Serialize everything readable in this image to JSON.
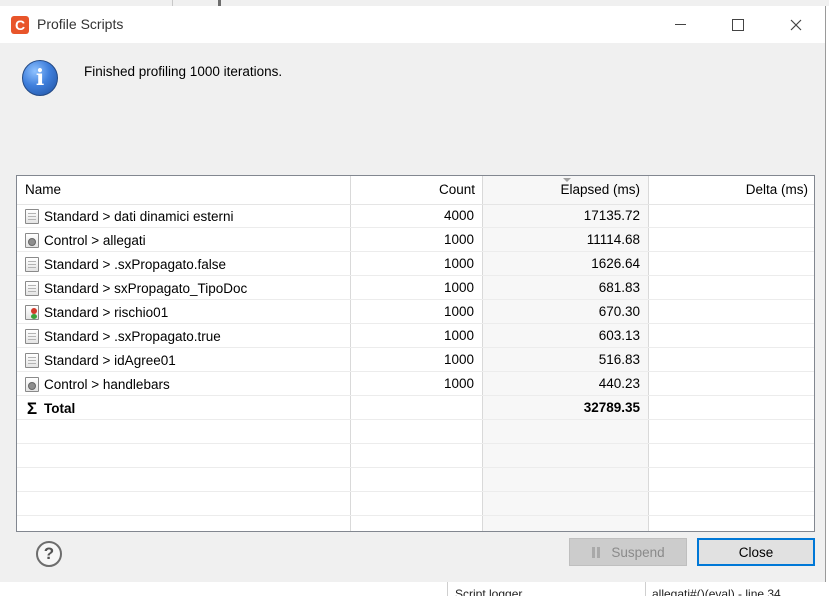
{
  "background": {
    "bottom_tabs": [
      "Script logger",
      "allegati#()(eval) - line 34"
    ]
  },
  "dialog": {
    "title": "Profile Scripts",
    "app_icon_letter": "C",
    "message": "Finished profiling 1000 iterations.",
    "columns": {
      "name": "Name",
      "count": "Count",
      "elapsed": "Elapsed (ms)",
      "delta": "Delta (ms)"
    },
    "rows": [
      {
        "icon": "script-icon",
        "name": "Standard > dati dinamici esterni",
        "count": "4000",
        "elapsed": "17135.72",
        "delta": ""
      },
      {
        "icon": "control-script-icon",
        "name": "Control > allegati",
        "count": "1000",
        "elapsed": "11114.68",
        "delta": ""
      },
      {
        "icon": "script-icon",
        "name": "Standard > .sxPropagato.false",
        "count": "1000",
        "elapsed": "1626.64",
        "delta": ""
      },
      {
        "icon": "script-icon",
        "name": "Standard > sxPropagato_TipoDoc",
        "count": "1000",
        "elapsed": "681.83",
        "delta": ""
      },
      {
        "icon": "breakpoint-script-icon",
        "name": "Standard > rischio01",
        "count": "1000",
        "elapsed": "670.30",
        "delta": ""
      },
      {
        "icon": "script-icon",
        "name": "Standard > .sxPropagato.true",
        "count": "1000",
        "elapsed": "603.13",
        "delta": ""
      },
      {
        "icon": "script-icon",
        "name": "Standard > idAgree01",
        "count": "1000",
        "elapsed": "516.83",
        "delta": ""
      },
      {
        "icon": "control-script-icon",
        "name": "Control > handlebars",
        "count": "1000",
        "elapsed": "440.23",
        "delta": ""
      }
    ],
    "total": {
      "icon": "sigma-icon",
      "name": "Total",
      "count": "",
      "elapsed": "32789.35",
      "delta": ""
    },
    "buttons": {
      "help": "?",
      "suspend": "Suspend",
      "close": "Close"
    },
    "colors": {
      "accent": "#0078d7",
      "app_icon": "#e8552a"
    }
  }
}
